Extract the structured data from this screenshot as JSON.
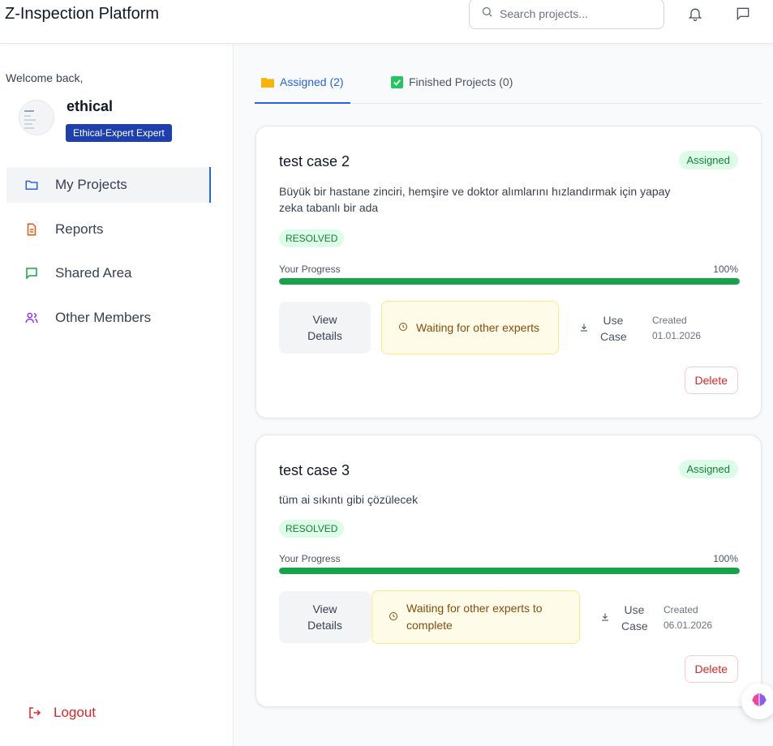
{
  "header": {
    "app_title": "Z-Inspection Platform",
    "search_placeholder": "Search projects..."
  },
  "sidebar": {
    "welcome": "Welcome back,",
    "username": "ethical",
    "role": "Ethical-Expert Expert",
    "items": [
      {
        "label": "My Projects",
        "icon": "folder-icon",
        "active": true
      },
      {
        "label": "Reports",
        "icon": "document-icon",
        "active": false
      },
      {
        "label": "Shared Area",
        "icon": "chat-icon",
        "active": false
      },
      {
        "label": "Other Members",
        "icon": "users-icon",
        "active": false
      }
    ],
    "logout": "Logout"
  },
  "tabs": [
    {
      "label": "Assigned (2)",
      "icon": "folder-icon",
      "active": true
    },
    {
      "label": "Finished Projects (0)",
      "icon": "checkbox-icon",
      "active": false
    }
  ],
  "projects": [
    {
      "title": "test case 2",
      "status": "Assigned",
      "description": "Büyük bir hastane zinciri, hemşire ve doktor alımlarını hızlandırmak için yapay zeka tabanlı bir ada",
      "state": "RESOLVED",
      "progress_label": "Your Progress",
      "progress_text": "100%",
      "progress": 100,
      "view_label": "View Details",
      "waiting": "Waiting for other experts",
      "usecase": "Use Case",
      "created_label": "Created",
      "created_date": "01.01.2026",
      "delete_label": "Delete"
    },
    {
      "title": "test case 3",
      "status": "Assigned",
      "description": "tüm ai sıkıntı gibi çözülecek",
      "state": "RESOLVED",
      "progress_label": "Your Progress",
      "progress_text": "100%",
      "progress": 100,
      "view_label": "View Details",
      "waiting": "Waiting for other experts to complete",
      "usecase": "Use Case",
      "created_label": "Created",
      "created_date": "06.01.2026",
      "delete_label": "Delete"
    }
  ],
  "colors": {
    "primary": "#2563eb",
    "badge": "#1e40af",
    "success": "#16a34a",
    "danger": "#dc2626",
    "warning_bg": "#fefce8"
  }
}
